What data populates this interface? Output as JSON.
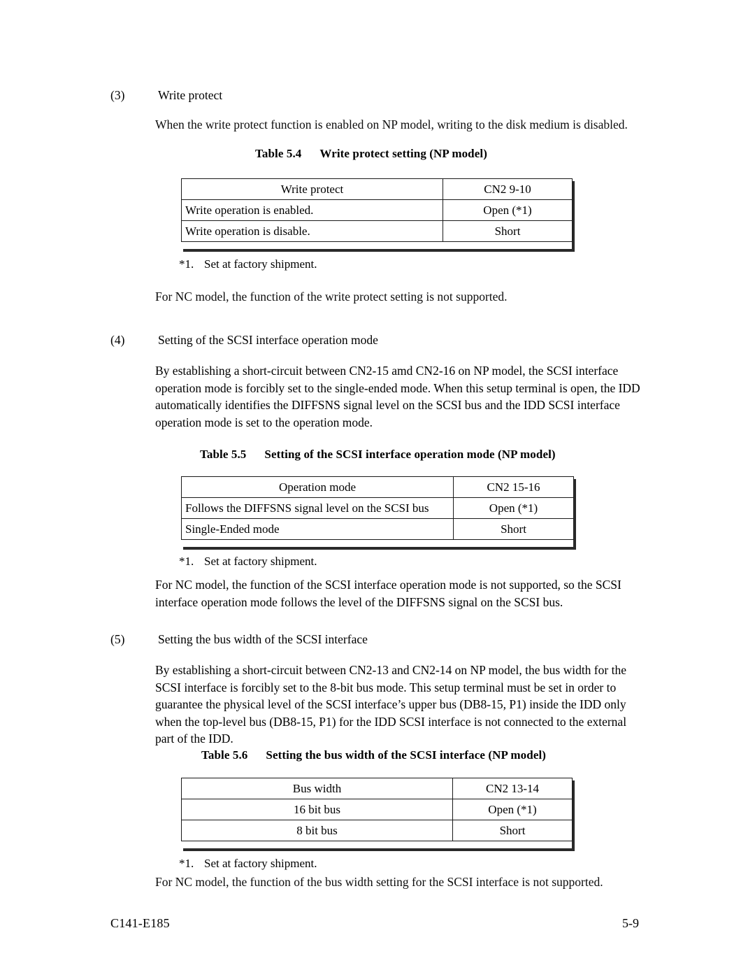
{
  "document": {
    "footer_left": "C141-E185",
    "footer_right": "5-9"
  },
  "sections": [
    {
      "number": "(3)",
      "heading": "Write protect",
      "intro": "When the write protect function is enabled on NP model, writing to the disk medium is disabled.",
      "closing": "For NC model, the function of the write protect setting is not supported."
    },
    {
      "number": "(4)",
      "heading": "Setting of the SCSI interface operation mode",
      "body_line_1": "By establishing a short-circuit between CN2-15 amd CN2-16 on NP model, the SCSI interface",
      "body_line_2": "operation mode is forcibly set to the single-ended mode. When this setup terminal is open, the IDD",
      "body_line_3": "automatically identifies the DIFFSNS signal level on the SCSI bus and the IDD SCSI interface",
      "body_line_4": "operation mode is set to the operation mode.",
      "closing_line_1": "For NC model, the function of the SCSI interface operation mode is not supported, so the SCSI",
      "closing_line_2": "interface operation mode follows the level of the DIFFSNS signal on the SCSI bus."
    },
    {
      "number": "(5)",
      "heading": "Setting the bus width of the SCSI interface",
      "body_line_1": "By establishing a short-circuit between CN2-13 and CN2-14 on NP model, the bus width for the",
      "body_line_2": "SCSI interface is forcibly set to the 8-bit bus mode. This setup terminal must be set in order to",
      "body_line_3": "guarantee the physical level of the SCSI interface’s upper bus (DB8-15, P1) inside the IDD only",
      "body_line_4": "when the top-level bus (DB8-15, P1) for the IDD SCSI interface is not connected to the external",
      "body_line_5": "part of the IDD.",
      "closing": "For NC model, the function of the bus width setting for the SCSI interface is not supported."
    }
  ],
  "tables": [
    {
      "id": "table-5-4",
      "caption_number": "Table 5.4",
      "caption_title": "Write protect setting (NP model)",
      "header": [
        "Write protect",
        "CN2 9-10"
      ],
      "rows": [
        [
          "Write operation is enabled.",
          "Open (*1)"
        ],
        [
          "Write operation is disable.",
          "Short"
        ]
      ],
      "footnote_mark": "*1.",
      "footnote_text": "Set at factory shipment."
    },
    {
      "id": "table-5-5",
      "caption_number": "Table 5.5",
      "caption_title": "Setting of the SCSI interface operation mode (NP model)",
      "header": [
        "Operation mode",
        "CN2 15-16"
      ],
      "rows": [
        [
          "Follows the DIFFSNS signal level on the SCSI bus",
          "Open (*1)"
        ],
        [
          "Single-Ended mode",
          "Short"
        ]
      ],
      "footnote_mark": "*1.",
      "footnote_text": "Set at factory shipment."
    },
    {
      "id": "table-5-6",
      "caption_number": "Table 5.6",
      "caption_title": "Setting the bus width of the SCSI interface  (NP model)",
      "header": [
        "Bus width",
        "CN2 13-14"
      ],
      "rows": [
        [
          "16 bit bus",
          "Open (*1)"
        ],
        [
          "8 bit bus",
          "Short"
        ]
      ],
      "footnote_mark": "*1.",
      "footnote_text": "Set at factory shipment."
    }
  ]
}
